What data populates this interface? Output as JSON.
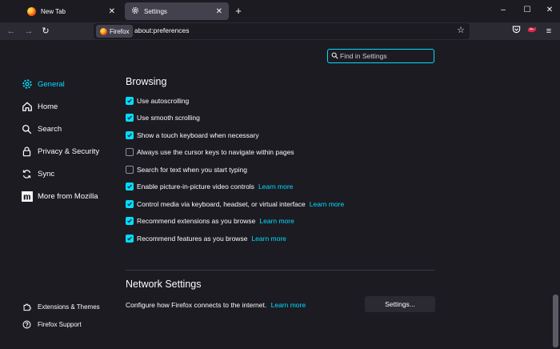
{
  "tabs": [
    {
      "title": "New Tab",
      "active": false
    },
    {
      "title": "Settings",
      "active": true
    }
  ],
  "window_controls": {
    "minimize": "–",
    "maximize": "☐",
    "close": "✕"
  },
  "navbar": {
    "identity_label": "Firefox",
    "url": "about:preferences"
  },
  "search": {
    "placeholder": "Find in Settings"
  },
  "sidebar": {
    "items": [
      {
        "label": "General",
        "icon": "gear-icon",
        "active": true
      },
      {
        "label": "Home",
        "icon": "home-icon"
      },
      {
        "label": "Search",
        "icon": "search-icon"
      },
      {
        "label": "Privacy & Security",
        "icon": "lock-icon"
      },
      {
        "label": "Sync",
        "icon": "sync-icon"
      },
      {
        "label": "More from Mozilla",
        "icon": "mozilla-icon"
      }
    ],
    "footer": [
      {
        "label": "Extensions & Themes",
        "icon": "puzzle-icon"
      },
      {
        "label": "Firefox Support",
        "icon": "help-icon"
      }
    ]
  },
  "browsing": {
    "heading": "Browsing",
    "learn_more": "Learn more",
    "options": [
      {
        "label": "Use autoscrolling",
        "checked": true
      },
      {
        "label": "Use smooth scrolling",
        "checked": true
      },
      {
        "label": "Show a touch keyboard when necessary",
        "checked": true
      },
      {
        "label": "Always use the cursor keys to navigate within pages",
        "checked": false
      },
      {
        "label": "Search for text when you start typing",
        "checked": false
      },
      {
        "label": "Enable picture-in-picture video controls",
        "checked": true,
        "link": "Learn more"
      },
      {
        "label": "Control media via keyboard, headset, or virtual interface",
        "checked": true,
        "link": "Learn more"
      },
      {
        "label": "Recommend extensions as you browse",
        "checked": true,
        "link": "Learn more"
      },
      {
        "label": "Recommend features as you browse",
        "checked": true,
        "link": "Learn more"
      }
    ]
  },
  "network": {
    "heading": "Network Settings",
    "description": "Configure how Firefox connects to the internet.",
    "link": "Learn more",
    "button": "Settings..."
  },
  "colors": {
    "accent": "#00ddff",
    "background": "#1c1b22",
    "toolbar": "#2b2a33"
  }
}
